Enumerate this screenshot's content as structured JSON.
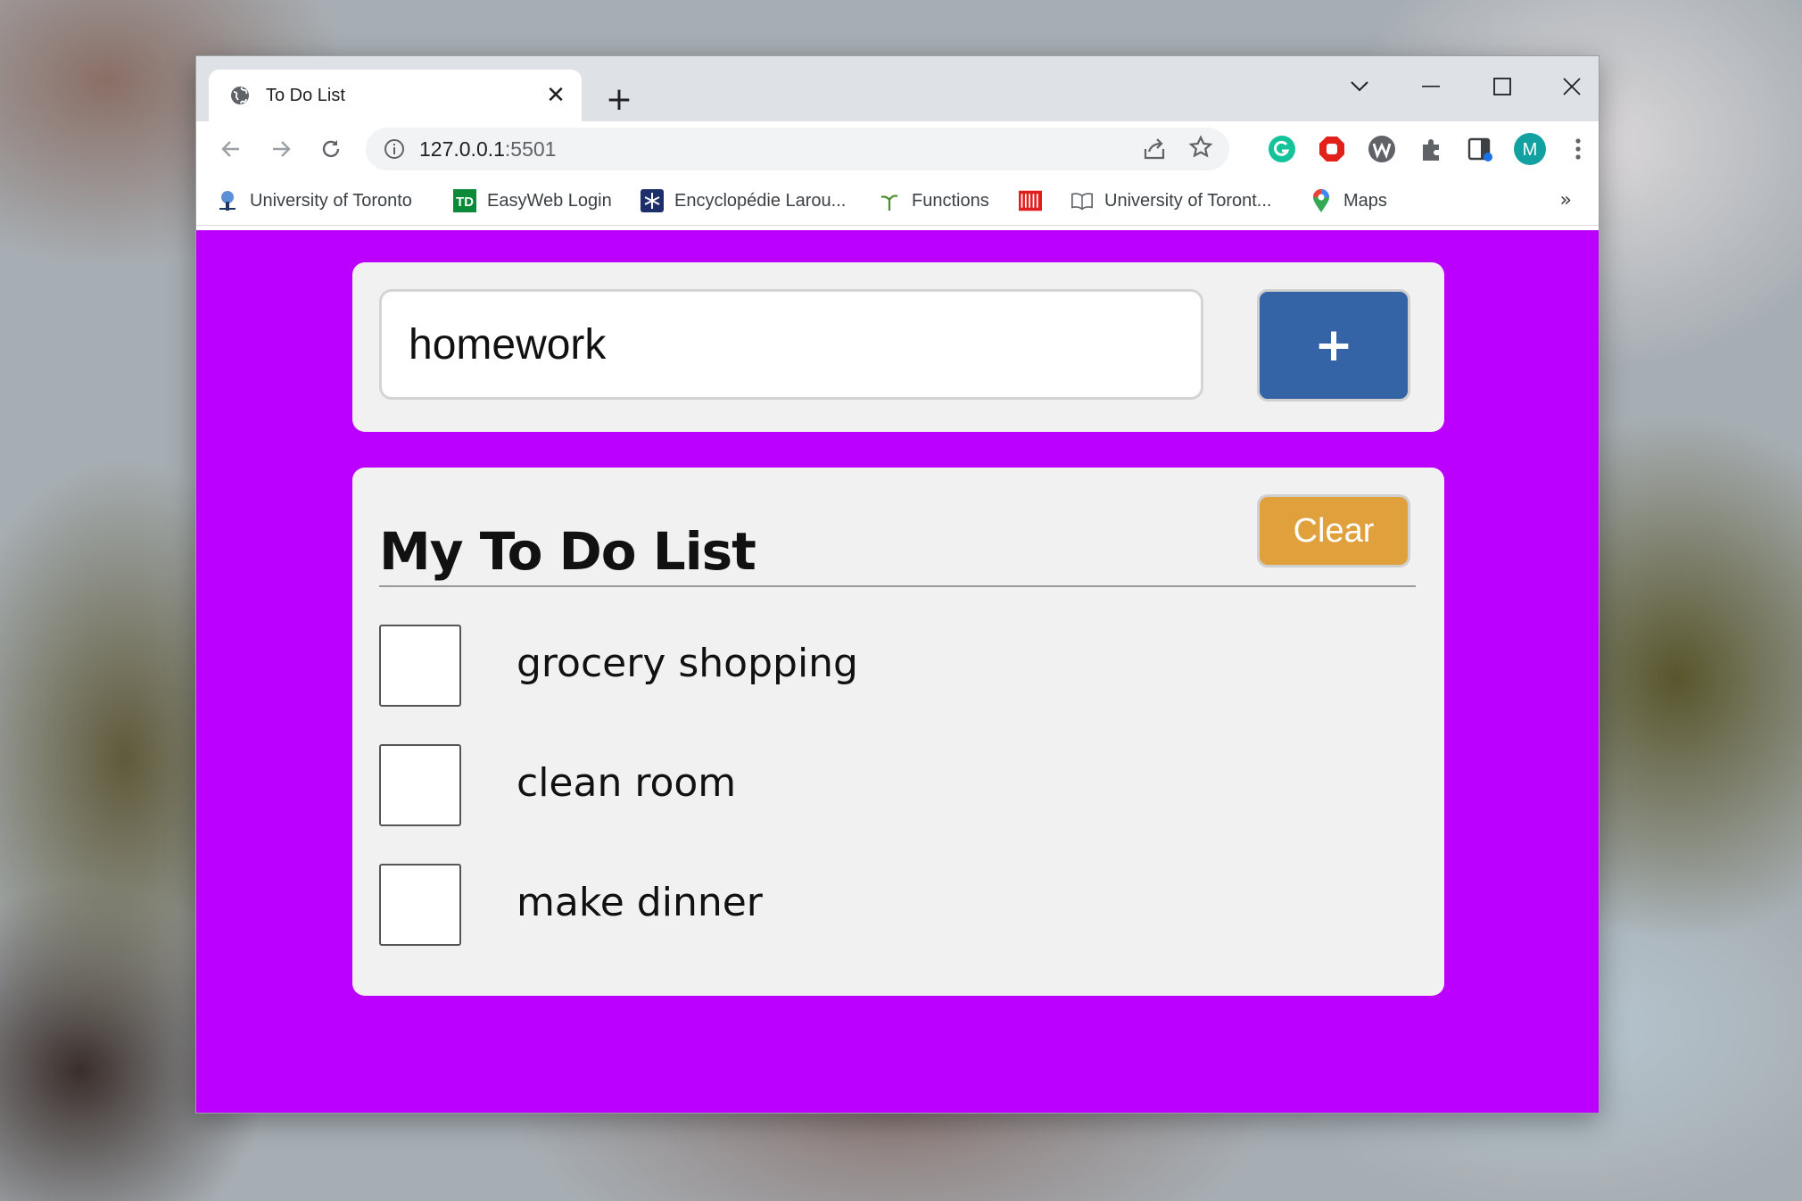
{
  "browser": {
    "tab": {
      "title": "To Do List",
      "close_symbol": "✕",
      "favicon": "globe-icon"
    },
    "new_tab_symbol": "+",
    "address": {
      "host": "127.0.0.1",
      "port": ":5501",
      "info_icon": "info-icon"
    },
    "profile_initial": "M",
    "bookmarks": [
      {
        "label": "University of Toronto",
        "icon": "uoft-crest-icon"
      },
      {
        "label": "EasyWeb Login",
        "icon": "td-logo-icon"
      },
      {
        "label": "Encyclopédie Larou...",
        "icon": "larousse-star-icon"
      },
      {
        "label": "Functions",
        "icon": "sprout-icon"
      },
      {
        "label": "",
        "icon": "red-bars-icon"
      },
      {
        "label": "University of Toront...",
        "icon": "book-icon"
      },
      {
        "label": "Maps",
        "icon": "maps-pin-icon"
      }
    ],
    "bookmarks_overflow": "»"
  },
  "app": {
    "input": {
      "value": "homework"
    },
    "add_button_label": "+",
    "list_title": "My To Do List",
    "clear_button_label": "Clear",
    "items": [
      {
        "text": "grocery shopping",
        "done": false
      },
      {
        "text": "clean room",
        "done": false
      },
      {
        "text": "make dinner",
        "done": false
      }
    ]
  },
  "colors": {
    "page_background": "#bb00ff",
    "add_button": "#3463a6",
    "clear_button": "#e0a13d",
    "card": "#f1f1f1"
  }
}
